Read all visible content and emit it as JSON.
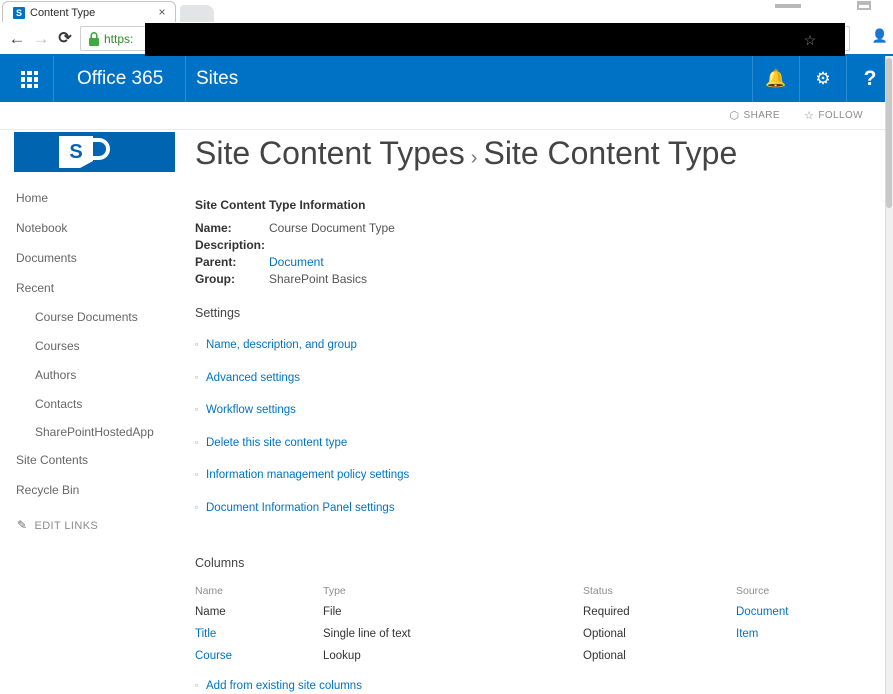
{
  "browser": {
    "tab_title": "Content Type",
    "tab_favicon": "sharepoint-favicon",
    "close_label": "×",
    "back_label": "←",
    "forward_label": "→",
    "reload_label": "⟳",
    "url_scheme": "https:",
    "bookmark_label": "☆",
    "profile_label": "👤"
  },
  "suite": {
    "waffle_name": "app-launcher",
    "brand": "Office 365",
    "app": "Sites",
    "notifications_label": "🔔",
    "settings_label": "⚙",
    "help_label": "?",
    "accent_color": "#0072C6"
  },
  "actions": {
    "share_label": "SHARE",
    "share_glyph": "⬡",
    "follow_label": "FOLLOW",
    "follow_glyph": "☆"
  },
  "header": {
    "logo_letter": "S",
    "logo_color": "#0064B0",
    "breadcrumb_parent": "Site Content Types",
    "breadcrumb_separator": "›",
    "breadcrumb_current": "Site Content Type"
  },
  "sidebar": {
    "items": [
      {
        "label": "Home",
        "child": false
      },
      {
        "label": "Notebook",
        "child": false
      },
      {
        "label": "Documents",
        "child": false
      },
      {
        "label": "Recent",
        "child": false
      },
      {
        "label": "Course Documents",
        "child": true
      },
      {
        "label": "Courses",
        "child": true
      },
      {
        "label": "Authors",
        "child": true
      },
      {
        "label": "Contacts",
        "child": true
      },
      {
        "label": "SharePointHostedApp",
        "child": true
      },
      {
        "label": "Site Contents",
        "child": false
      },
      {
        "label": "Recycle Bin",
        "child": false
      }
    ],
    "edit_links_label": "EDIT LINKS",
    "edit_links_glyph": "✎"
  },
  "main": {
    "info_heading": "Site Content Type Information",
    "info_rows": [
      {
        "label": "Name:",
        "value": "Course Document Type",
        "is_link": false
      },
      {
        "label": "Description:",
        "value": "",
        "is_link": false
      },
      {
        "label": "Parent:",
        "value": "Document",
        "is_link": true
      },
      {
        "label": "Group:",
        "value": "SharePoint Basics",
        "is_link": false
      }
    ],
    "settings_heading": "Settings",
    "settings_links": [
      "Name, description, and group",
      "Advanced settings",
      "Workflow settings",
      "Delete this site content type",
      "Information management policy settings",
      "Document Information Panel settings"
    ],
    "columns_heading": "Columns",
    "columns_table": {
      "headers": [
        "Name",
        "Type",
        "Status",
        "Source"
      ],
      "rows": [
        {
          "name": "Name",
          "name_link": false,
          "type": "File",
          "status": "Required",
          "source": "Document",
          "source_link": true
        },
        {
          "name": "Title",
          "name_link": true,
          "type": "Single line of text",
          "status": "Optional",
          "source": "Item",
          "source_link": true
        },
        {
          "name": "Course",
          "name_link": true,
          "type": "Lookup",
          "status": "Optional",
          "source": "",
          "source_link": false
        }
      ]
    },
    "add_columns_label": "Add from existing site columns",
    "bullet_glyph": "▫"
  }
}
